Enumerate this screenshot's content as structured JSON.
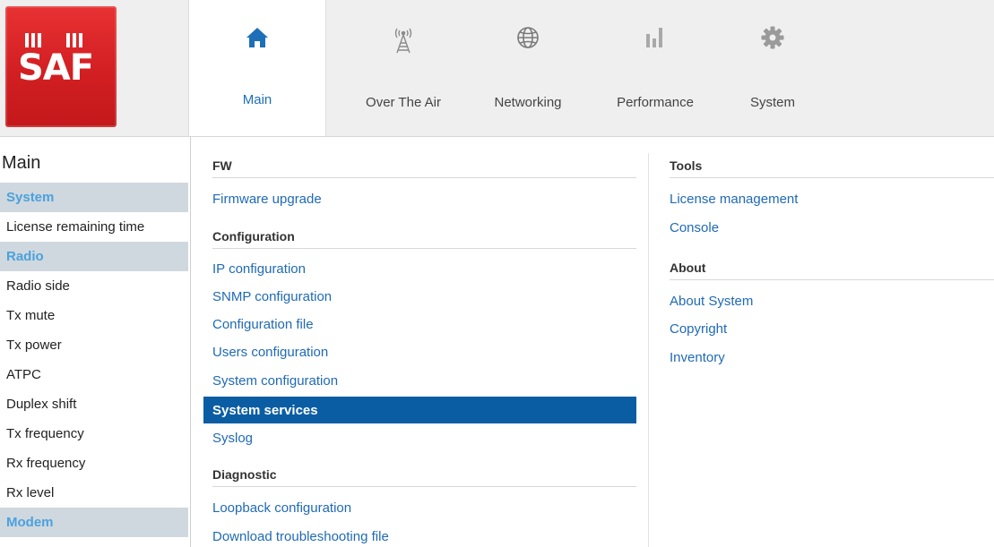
{
  "logo": {
    "text": "SAF"
  },
  "nav": {
    "items": [
      {
        "label": "Main",
        "icon": "home-icon",
        "active": true
      },
      {
        "label": "Over The Air",
        "icon": "antenna-icon"
      },
      {
        "label": "Networking",
        "icon": "globe-icon"
      },
      {
        "label": "Performance",
        "icon": "bar-chart-icon"
      },
      {
        "label": "System",
        "icon": "gear-icon"
      }
    ]
  },
  "left_panel": {
    "title": "Main",
    "rows": [
      {
        "label": "System",
        "section": true
      },
      {
        "label": "License remaining time"
      },
      {
        "label": "Radio",
        "section": true
      },
      {
        "label": "Radio side"
      },
      {
        "label": "Tx mute"
      },
      {
        "label": "Tx power"
      },
      {
        "label": "ATPC"
      },
      {
        "label": "Duplex shift"
      },
      {
        "label": "Tx frequency"
      },
      {
        "label": "Rx frequency"
      },
      {
        "label": "Rx level"
      },
      {
        "label": "Modem",
        "section": true
      }
    ]
  },
  "menu": {
    "left": {
      "fw": "FW",
      "firmware_upgrade": "Firmware upgrade",
      "configuration": "Configuration",
      "ip_configuration": "IP configuration",
      "snmp_configuration": "SNMP configuration",
      "configuration_file": "Configuration file",
      "users_configuration": "Users configuration",
      "system_configuration": "System configuration",
      "system_services": "System services",
      "syslog": "Syslog",
      "diagnostic": "Diagnostic",
      "loopback_configuration": "Loopback configuration",
      "download_troubleshooting": "Download troubleshooting file"
    },
    "right": {
      "tools": "Tools",
      "license_management": "License management",
      "console": "Console",
      "about": "About",
      "about_system": "About System",
      "copyright": "Copyright",
      "inventory": "Inventory"
    },
    "active_item": "System services"
  },
  "colors": {
    "brand_red": "#d21f22",
    "link_blue": "#1f6ab5",
    "active_bg": "#0b5da3",
    "section_bg": "#cfd8de",
    "section_text": "#4ba1de"
  }
}
